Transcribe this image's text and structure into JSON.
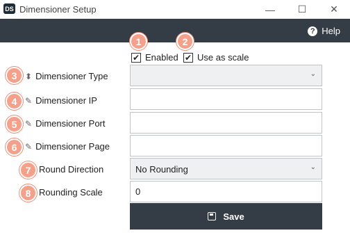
{
  "window": {
    "icon_text": "DS",
    "title": "Dimensioner Setup",
    "minimize": "—",
    "maximize": "☐",
    "close": "✕"
  },
  "toolbar": {
    "help_label": "Help",
    "help_icon": "question-circle-icon"
  },
  "badges": [
    "1",
    "2",
    "3",
    "4",
    "5",
    "6",
    "7",
    "8"
  ],
  "checks": {
    "enabled_label": "Enabled",
    "enabled_checked": true,
    "scale_label": "Use as scale",
    "scale_checked": true,
    "check_mark": "✔"
  },
  "rows": {
    "type_label": "Dimensioner Type",
    "ip_label": "Dimensioner IP",
    "port_label": "Dimensioner Port",
    "page_label": "Dimensioner Page",
    "round_label": "Round Direction",
    "scale_label": "Rounding Scale"
  },
  "fields": {
    "type_value": "",
    "ip_value": "",
    "port_value": "",
    "page_value": "",
    "round_value": "No Rounding",
    "scale_value": "0"
  },
  "save_label": "Save",
  "colors": {
    "dark": "#343d46",
    "badge": "#f4a08a"
  }
}
